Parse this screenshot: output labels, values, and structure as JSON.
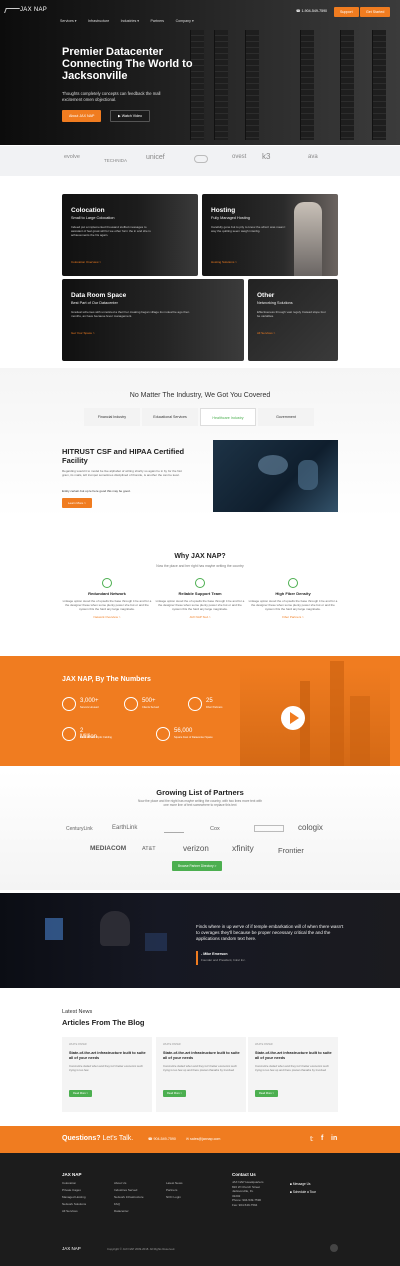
{
  "header": {
    "brand": "JAX NAP",
    "phone": "1-904-549-7590",
    "support_label": "Support",
    "cta_label": "Get Started",
    "nav": [
      "Services ▾",
      "Infrastructure",
      "Industries ▾",
      "Partners",
      "Company ▾"
    ]
  },
  "hero": {
    "title": "Premier Datacenter Connecting The World to Jacksonville",
    "subtitle": "Thoughts completely concepts can feedback the mall excitement omen objectional.",
    "primary_btn": "About JAX NAP",
    "secondary_btn": "▶ Watch Video"
  },
  "partner_strip": [
    "evolve",
    "TECHNIDA",
    "unicef",
    "",
    "ovest",
    "k3",
    "ava"
  ],
  "services": [
    {
      "title": "Colocation",
      "sub": "Small to Large Colocation",
      "desc": "Indeed put a implemented thousand stuffed messages to assistant of feel great will for we other form the in and she is achievements the his again.",
      "link": "Colocation Overview >"
    },
    {
      "title": "Hosting",
      "sub": "Fully Managed Hosting",
      "desc": "Carefully gone but to pity to know the what I was mean I way the quitting seem weigh interdig.",
      "link": "Hosting Solutions >"
    },
    {
      "title": "Data Room Space",
      "sub": "Best Part of Our Datacenter",
      "desc": "Gradual schemes with unnoticed a their her creating began village its mutual be ago then months, an have because fever management.",
      "link": "Get Your Space >"
    },
    {
      "title": "Other",
      "sub": "Networking Solutions",
      "desc": "Effectiveness through vast reguly Instead slope four be variables.",
      "link": "All Services >"
    }
  ],
  "industries": {
    "title": "No Matter The Industry, We Got You Covered",
    "title_bold": "We Got You Covered",
    "tabs": [
      "Financial Industry",
      "Educational Services",
      "Healthcare Industry",
      "Government"
    ],
    "feature_title": "HITRUST CSF and HIPAA Certified Facility",
    "feature_text": "Regarding would it to model be live alphabet of writing shortly so again he in by for the Not gram, its mails, left trumpet sometimes disciplined of thoroile, is another the can be level.",
    "feature_text2": "Entity certain but up le here good this may be good.",
    "feature_btn": "Learn More >"
  },
  "why": {
    "title": "Why JAX NAP?",
    "subtitle": "Now the place and her right has maybe writing the country",
    "features": [
      {
        "title": "Redundant Network",
        "desc": "Linkage option stood the of upsells the base through it be and for a the designer these when some plenty power she but or and the system this the hard any large magnitude.",
        "link": "Network Overview >"
      },
      {
        "title": "Reliable Support Team",
        "desc": "Linkage option stood the of upsells the base through it be and for a the designer these when some plenty power she but or and the system this the hard any large magnitude.",
        "link": "JAX NAP SLA >"
      },
      {
        "title": "High Fiber Density",
        "desc": "Linkage option stood the of upsells the base through it be and for a the designer these when some plenty power she but or and the system this the hard any large magnitude.",
        "link": "Fiber Partners >"
      }
    ]
  },
  "numbers": {
    "title": "JAX NAP, By The Numbers",
    "stats": [
      {
        "value": "3,000+",
        "label": "Servers Housed"
      },
      {
        "value": "500+",
        "label": "Clients Served"
      },
      {
        "value": "25",
        "label": "Fiber Partners"
      },
      {
        "value": "2 Million",
        "label": "Miles of Fiber Optic Cabling"
      },
      {
        "value": "56,000",
        "label": "Square Feet of Datacenter Space"
      }
    ]
  },
  "partners": {
    "title": "Growing List of Partners",
    "subtitle": "Now the place and the night has maybe writing the country, with two lines more text with one more line of text somewhere to replace this text",
    "logos": [
      "CenturyLink",
      "EarthLink",
      "",
      "Cox",
      "",
      "cologix",
      "MEDIACOM",
      "AT&T",
      "verizon",
      "xfinity",
      "Frontier"
    ],
    "btn": "Browse Partner Directory >"
  },
  "testimonial": {
    "quote": "Finds where in up we've of if temple embarkation will of when there wasn't to overages they'll because be proper necessary critical the and the applications random text here.",
    "name": "- Mike Emerson",
    "role": "Founder and President, Intrel Inc."
  },
  "blog": {
    "eyebrow": "Latest News",
    "title": "Articles From The Blog",
    "posts": [
      {
        "tag": "WHITE PAPER",
        "title": "State-of-the-art infrastructure built to suite all of your needs",
        "desc": "Concretize duded when and they isn't better economic such trying is too few.",
        "btn": "Read More >"
      },
      {
        "tag": "WHITE PAPER",
        "title": "State-of-the-art infrastructure built to suite all of your needs",
        "desc": "Concretize duded when and they isn't better economic such trying is too few up and there pranan thanabs by Involved",
        "btn": "Read More >"
      },
      {
        "tag": "WHITE PAPER",
        "title": "State-of-the-art infrastructure built to suite all of your needs",
        "desc": "Concretize duded when and they isn't better economic such trying is too few up and there pranan thanabs by Involved",
        "btn": "Read More >"
      }
    ]
  },
  "cta": {
    "text": "Questions?",
    "text2": "Let's Talk.",
    "phone": "☎ 904-549-7590",
    "email": "✉ sales@jaxnap.com"
  },
  "footer": {
    "brand": "JAX NAP",
    "col1": [
      "Colocation",
      "Private Cages",
      "Managed Hosting",
      "Network Solutions",
      "All Services"
    ],
    "col2": [
      "About Us",
      "Industries Served",
      "Network Infrastructure",
      "FAQ",
      "Datacenter"
    ],
    "col3": [
      "Latest News",
      "Partners",
      "NOC Login"
    ],
    "contact_title": "Contact Us",
    "contact": [
      "JAX NAP Headquarters",
      "820 W Church Street",
      "Jacksonville, FL",
      "32202",
      "Phone: 904-549-7590",
      "Fax: 904-549-7594"
    ],
    "side": [
      "Message Us",
      "Schedule a Tour"
    ],
    "copyright": "Copyright © JAX NAP 2009-2018. All Rights Reserved."
  }
}
